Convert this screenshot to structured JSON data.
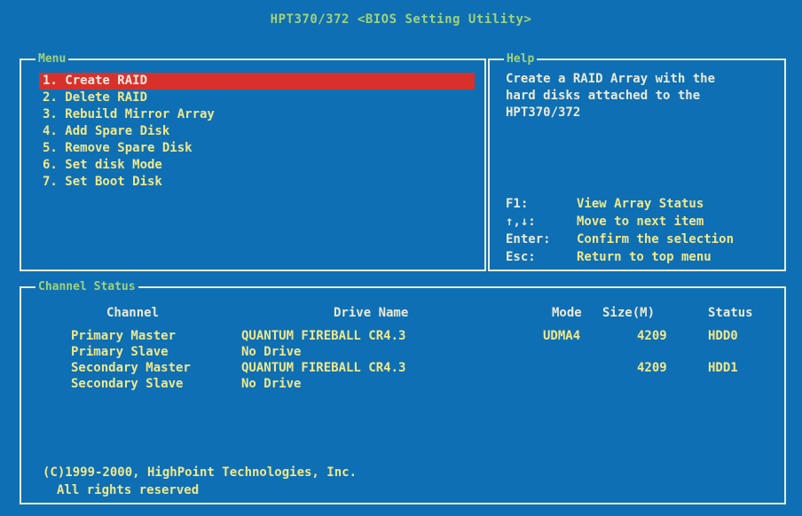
{
  "title": "HPT370/372 <BIOS Setting Utility>",
  "menu": {
    "label": "Menu",
    "items": [
      {
        "label": "1. Create RAID"
      },
      {
        "label": "2. Delete RAID"
      },
      {
        "label": "3. Rebuild Mirror Array"
      },
      {
        "label": "4. Add Spare Disk"
      },
      {
        "label": "5. Remove Spare Disk"
      },
      {
        "label": "6. Set disk Mode"
      },
      {
        "label": "7. Set Boot Disk"
      }
    ],
    "selected_index": 0
  },
  "help": {
    "label": "Help",
    "text": "Create a RAID Array with the\nhard disks attached to the\nHPT370/372",
    "keys": [
      {
        "key": "F1:",
        "desc": "View Array Status"
      },
      {
        "key": "↑,↓:",
        "desc": "Move to next item"
      },
      {
        "key": "Enter:",
        "desc": "Confirm the selection"
      },
      {
        "key": "Esc:",
        "desc": "Return to top menu"
      }
    ]
  },
  "channel_status": {
    "label": "Channel Status",
    "headers": {
      "channel": "Channel",
      "drive_name": "Drive Name",
      "mode": "Mode",
      "size": "Size(M)",
      "status": "Status"
    },
    "rows": [
      {
        "channel": "Primary Master",
        "drive_name": "QUANTUM FIREBALL CR4.3",
        "mode": "UDMA4",
        "size": "4209",
        "status": "HDD0"
      },
      {
        "channel": "Primary Slave",
        "drive_name": "No Drive",
        "mode": "",
        "size": "",
        "status": ""
      },
      {
        "channel": "Secondary Master",
        "drive_name": "QUANTUM FIREBALL CR4.3",
        "mode": "",
        "size": "4209",
        "status": "HDD1"
      },
      {
        "channel": "Secondary Slave",
        "drive_name": "No Drive",
        "mode": "",
        "size": "",
        "status": ""
      }
    ],
    "copyright_line1": "(C)1999-2000, HighPoint Technologies, Inc.",
    "copyright_line2": "All rights reserved"
  },
  "colors": {
    "background": "#0f6fb4",
    "highlight": "#d8312b",
    "text": "#f0e88a",
    "title": "#9fd37a"
  }
}
